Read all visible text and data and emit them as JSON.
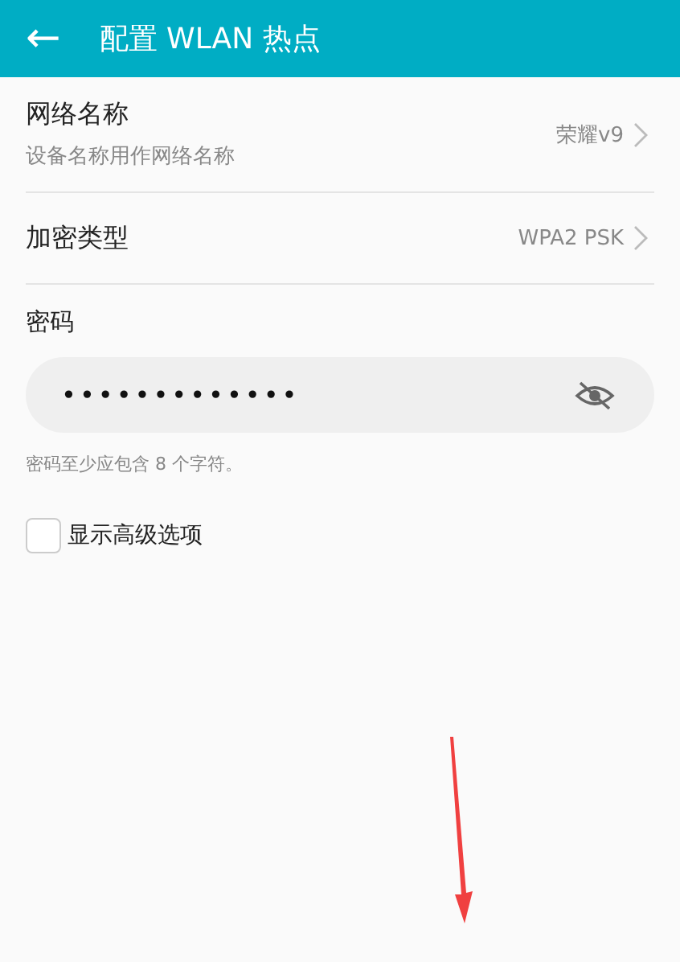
{
  "header": {
    "back_icon": "←",
    "title": "配置 WLAN 热点"
  },
  "settings": [
    {
      "label": "网络名称",
      "subtitle": "设备名称用作网络名称",
      "value": "荣耀v9"
    },
    {
      "label": "加密类型",
      "value": "WPA2 PSK"
    }
  ],
  "password": {
    "label": "密码",
    "value": "•••••••••••••",
    "visible": false,
    "hint": "密码至少应包含 8 个字符。"
  },
  "advanced": {
    "label": "显示高级选项",
    "checked": false
  }
}
